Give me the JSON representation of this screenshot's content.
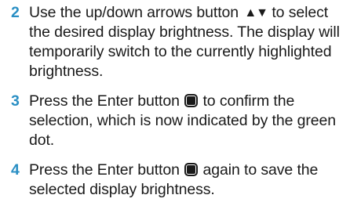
{
  "steps": [
    {
      "number": "2",
      "text_before": "Use the up/down arrows button ",
      "icon_glyph": "▲▼",
      "text_after": " to select the desired display brightness. The display will temporarily switch to the currently highlighted brightness."
    },
    {
      "number": "3",
      "text_before": "Press the Enter button ",
      "text_after": " to confirm the selection, which is now indicated by the green dot."
    },
    {
      "number": "4",
      "text_before": "Press the Enter button ",
      "text_after": " again to save the selected display brightness."
    }
  ],
  "colors": {
    "step_number": "#2a8fc4",
    "text": "#1a1a1a"
  },
  "icons": {
    "up_down": "up-down-arrows-icon",
    "enter": "enter-button-icon"
  }
}
